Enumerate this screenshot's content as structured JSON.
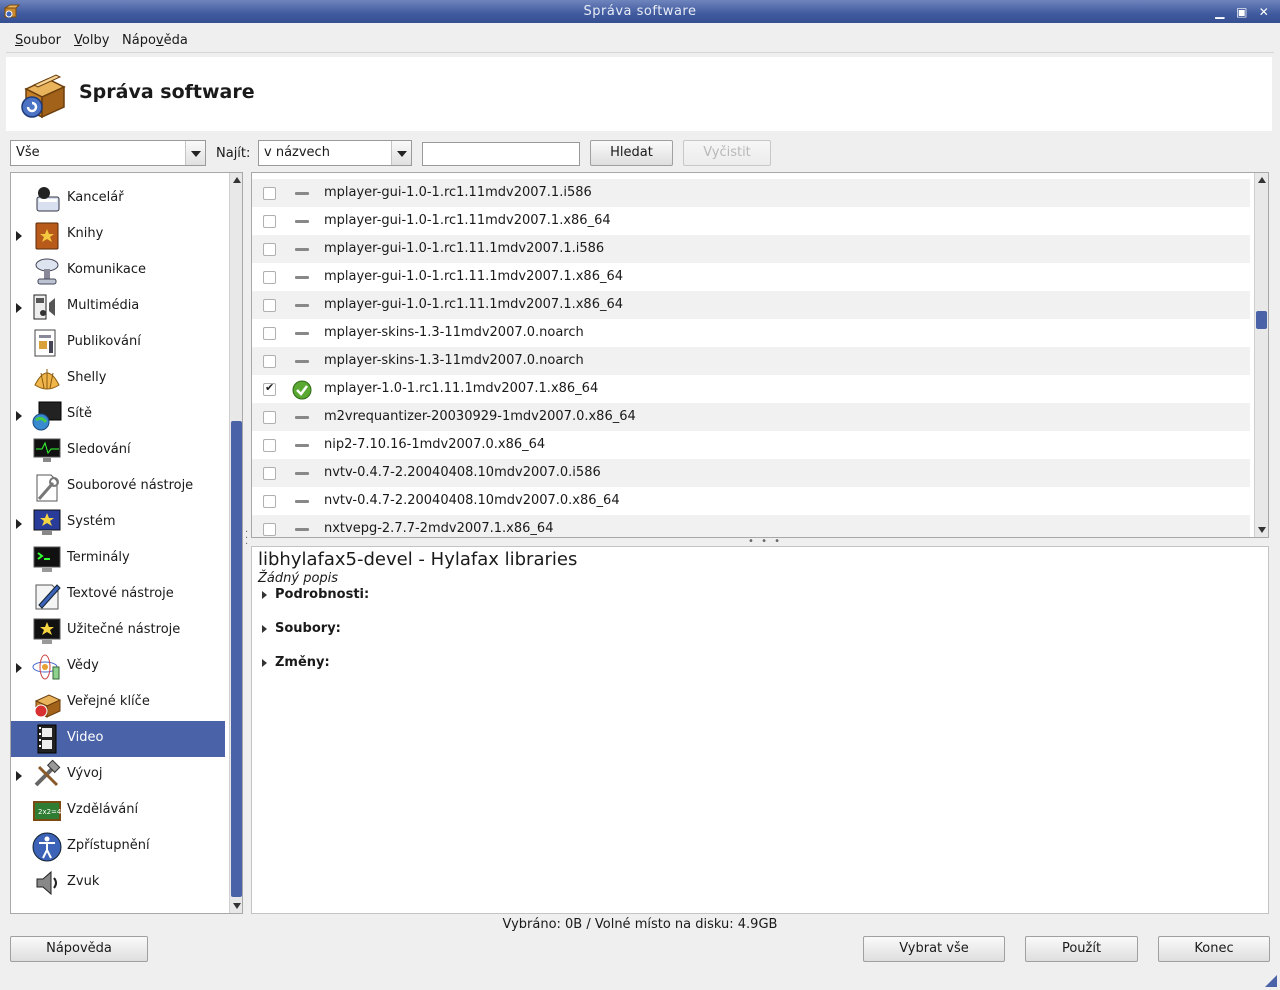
{
  "window": {
    "title": "Správa software"
  },
  "menu": [
    {
      "prefix": "",
      "accel": "S",
      "rest": "oubor"
    },
    {
      "prefix": "",
      "accel": "V",
      "rest": "olby"
    },
    {
      "prefix": "Nápo",
      "accel": "v",
      "rest": "ěda"
    }
  ],
  "header": {
    "title": "Správa software"
  },
  "filter": {
    "group_value": "Vše",
    "find_label": "Najít:",
    "find_mode": "v názvech",
    "search_value": "",
    "search_button": "Hledat",
    "clear_button": "Vyčistit"
  },
  "categories": [
    {
      "name": "Kancelář",
      "expandable": false,
      "selected": false,
      "icon": "office-icon"
    },
    {
      "name": "Knihy",
      "expandable": true,
      "selected": false,
      "icon": "books-icon"
    },
    {
      "name": "Komunikace",
      "expandable": false,
      "selected": false,
      "icon": "communication-icon"
    },
    {
      "name": "Multimédia",
      "expandable": true,
      "selected": false,
      "icon": "multimedia-icon"
    },
    {
      "name": "Publikování",
      "expandable": false,
      "selected": false,
      "icon": "publishing-icon"
    },
    {
      "name": "Shelly",
      "expandable": false,
      "selected": false,
      "icon": "shell-icon"
    },
    {
      "name": "Sítě",
      "expandable": true,
      "selected": false,
      "icon": "network-icon"
    },
    {
      "name": "Sledování",
      "expandable": false,
      "selected": false,
      "icon": "monitoring-icon"
    },
    {
      "name": "Souborové nástroje",
      "expandable": false,
      "selected": false,
      "icon": "file-tools-icon"
    },
    {
      "name": "Systém",
      "expandable": true,
      "selected": false,
      "icon": "system-icon"
    },
    {
      "name": "Terminály",
      "expandable": false,
      "selected": false,
      "icon": "terminal-icon"
    },
    {
      "name": "Textové nástroje",
      "expandable": false,
      "selected": false,
      "icon": "text-tools-icon"
    },
    {
      "name": "Užitečné nástroje",
      "expandable": false,
      "selected": false,
      "icon": "utilities-icon"
    },
    {
      "name": "Vědy",
      "expandable": true,
      "selected": false,
      "icon": "sciences-icon"
    },
    {
      "name": "Veřejné klíče",
      "expandable": false,
      "selected": false,
      "icon": "public-keys-icon"
    },
    {
      "name": "Video",
      "expandable": false,
      "selected": true,
      "icon": "video-icon"
    },
    {
      "name": "Vývoj",
      "expandable": true,
      "selected": false,
      "icon": "development-icon"
    },
    {
      "name": "Vzdělávání",
      "expandable": false,
      "selected": false,
      "icon": "education-icon"
    },
    {
      "name": "Zpřístupnění",
      "expandable": false,
      "selected": false,
      "icon": "accessibility-icon"
    },
    {
      "name": "Zvuk",
      "expandable": false,
      "selected": false,
      "icon": "sound-icon"
    }
  ],
  "packages": [
    {
      "name": "mplayer-gui-1.0-1.rc1.11mdv2007.1.i586",
      "checked": false,
      "installed": false
    },
    {
      "name": "mplayer-gui-1.0-1.rc1.11mdv2007.1.x86_64",
      "checked": false,
      "installed": false
    },
    {
      "name": "mplayer-gui-1.0-1.rc1.11.1mdv2007.1.i586",
      "checked": false,
      "installed": false
    },
    {
      "name": "mplayer-gui-1.0-1.rc1.11.1mdv2007.1.x86_64",
      "checked": false,
      "installed": false
    },
    {
      "name": "mplayer-gui-1.0-1.rc1.11.1mdv2007.1.x86_64",
      "checked": false,
      "installed": false
    },
    {
      "name": "mplayer-skins-1.3-11mdv2007.0.noarch",
      "checked": false,
      "installed": false
    },
    {
      "name": "mplayer-skins-1.3-11mdv2007.0.noarch",
      "checked": false,
      "installed": false
    },
    {
      "name": "mplayer-1.0-1.rc1.11.1mdv2007.1.x86_64",
      "checked": true,
      "installed": true
    },
    {
      "name": "m2vrequantizer-20030929-1mdv2007.0.x86_64",
      "checked": false,
      "installed": false
    },
    {
      "name": "nip2-7.10.16-1mdv2007.0.x86_64",
      "checked": false,
      "installed": false
    },
    {
      "name": "nvtv-0.4.7-2.20040408.10mdv2007.0.i586",
      "checked": false,
      "installed": false
    },
    {
      "name": "nvtv-0.4.7-2.20040408.10mdv2007.0.x86_64",
      "checked": false,
      "installed": false
    },
    {
      "name": "nxtvepg-2.7.7-2mdv2007.1.x86_64",
      "checked": false,
      "installed": false
    }
  ],
  "detail": {
    "title": "libhylafax5-devel - Hylafax libraries",
    "description": "Žádný popis",
    "sections": [
      "Podrobnosti:",
      "Soubory:",
      "Změny:"
    ]
  },
  "status": {
    "text": "Vybráno: 0B / Volné místo na disku: 4.9GB"
  },
  "buttons": {
    "help": "Nápověda",
    "select_all": "Vybrat vše",
    "apply": "Použít",
    "quit": "Konec"
  },
  "colors": {
    "title_bar": "#3f5a9e",
    "selection": "#4a63a8",
    "ok_green": "#5aa832"
  }
}
